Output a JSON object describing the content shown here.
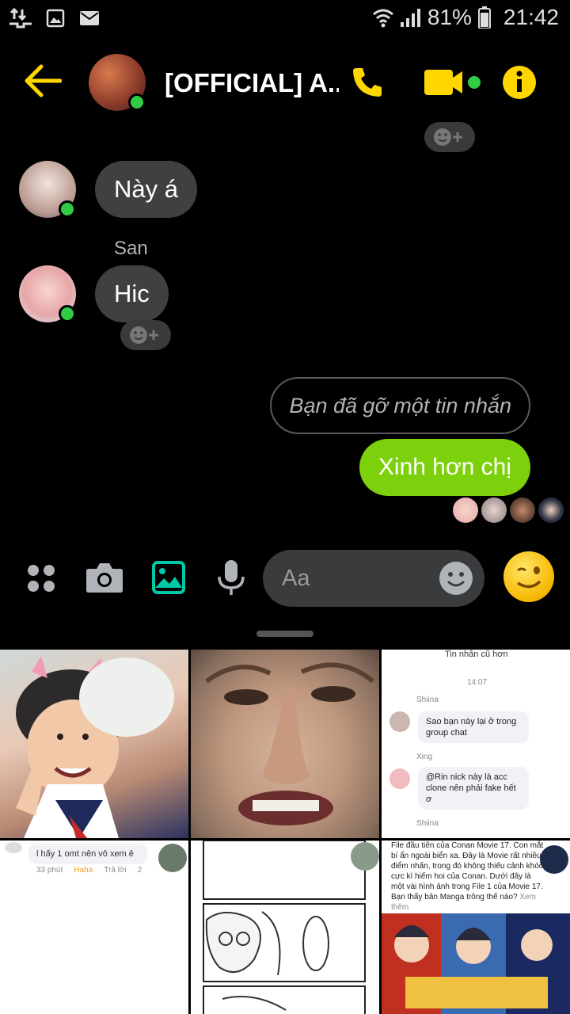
{
  "status_bar": {
    "battery_text": "81%",
    "time": "21:42",
    "left_icons": [
      "data-transfer-icon",
      "image-icon",
      "mail-icon"
    ],
    "right_icons": [
      "wifi-icon",
      "signal-icon",
      "battery-icon"
    ]
  },
  "header": {
    "title": "[OFFICIAL] A...",
    "accent_color": "#ffd600",
    "online_color": "#31cc46"
  },
  "messages": [
    {
      "from": "other",
      "text": "Này á"
    },
    {
      "from": "other",
      "sender": "San",
      "text": "Hic"
    },
    {
      "from": "me",
      "removed_text": "Bạn đã gỡ một tin nhắn"
    },
    {
      "from": "me",
      "text": "Xinh hơn chị",
      "bubble_color": "#7dd10c"
    }
  ],
  "composer": {
    "placeholder": "Aa",
    "icons": [
      "more-apps-icon",
      "camera-icon",
      "gallery-icon",
      "microphone-icon",
      "emoji-icon",
      "wink-emoji-icon"
    ]
  },
  "gallery": {
    "tile3": {
      "header": "Tin nhắn cũ hơn",
      "time": "14:07",
      "sender1": "Shiina",
      "msg1": "Sao bạn này lại ở trong group chat",
      "sender2": "Xing",
      "msg2": "@Rin nick này là acc clone nên phải fake hết ơ",
      "sender3": "Shiina"
    },
    "tile4": {
      "comment": "l hấy 1 omt nên vô xem ê",
      "age": "33 phút",
      "reaction": "Haha",
      "reply": "Trả lời",
      "count": "2"
    },
    "tile6": {
      "text": "File đầu tiên của Conan Movie 17. Con mắt bí ẩn ngoài biển xa. Đây là Movie rất nhiều điểm nhấn, trong đó không thiếu cảnh khóc cực kì hiếm hoi của Conan. Dưới đây là một vài hình ảnh trong File 1 của Movie 17. Bạn thấy bản Manga trông thế nào?",
      "more": "Xem thêm"
    }
  }
}
